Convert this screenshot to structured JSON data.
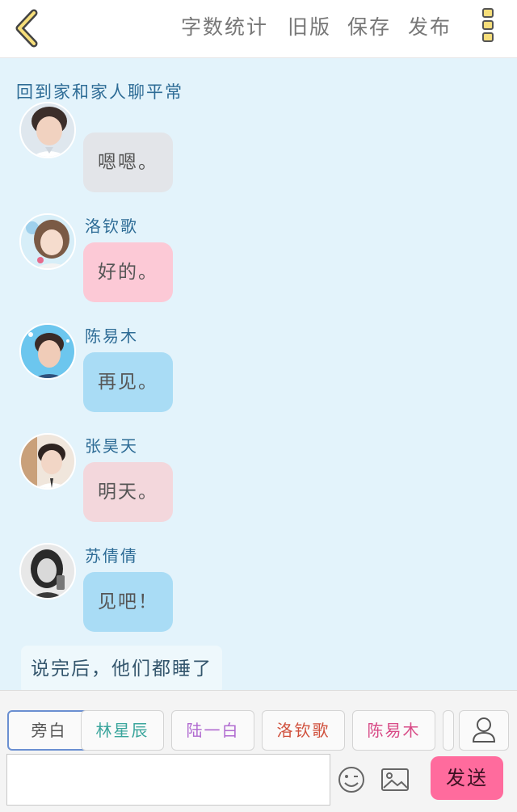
{
  "header": {
    "back_icon": "chevron-left-icon",
    "actions": [
      "字数统计",
      "旧版",
      "保存",
      "发布"
    ],
    "more_icon": "kebab-menu-icon"
  },
  "chapter_title": "回到家和家人聊平常",
  "messages": [
    {
      "name": "",
      "text": "嗯嗯。",
      "bubble_color": "#e3e5e9",
      "avatar_icon": "boy-avatar"
    },
    {
      "name": "洛钦歌",
      "text": "好的。",
      "bubble_color": "#fcc9d6",
      "avatar_icon": "girl-avatar"
    },
    {
      "name": "陈易木",
      "text": "再见。",
      "bubble_color": "#a9dcf5",
      "avatar_icon": "boy-avatar"
    },
    {
      "name": "张昊天",
      "text": "明天。",
      "bubble_color": "#f3d7dc",
      "avatar_icon": "boy-avatar"
    },
    {
      "name": "苏倩倩",
      "text": "见吧！",
      "bubble_color": "#a9dcf5",
      "avatar_icon": "girl-avatar"
    }
  ],
  "narration": "说完后，他们都睡了",
  "roles": [
    {
      "label": "旁白",
      "color": "#555555",
      "active": true
    },
    {
      "label": "林星辰",
      "color": "#3aa59c"
    },
    {
      "label": "陆一白",
      "color": "#b06ad0"
    },
    {
      "label": "洛钦歌",
      "color": "#d0503c"
    },
    {
      "label": "陈易木",
      "color": "#d84a86"
    }
  ],
  "input": {
    "value": "",
    "placeholder": ""
  },
  "send_label": "发送"
}
